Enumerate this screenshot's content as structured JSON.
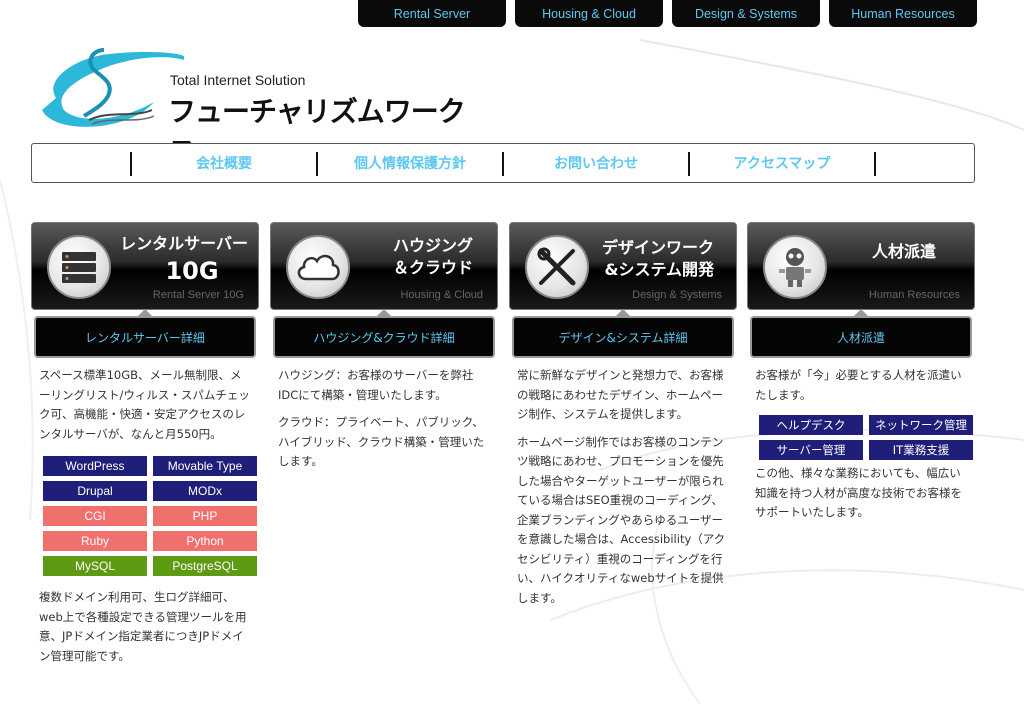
{
  "top_nav": [
    "Rental Server",
    "Housing & Cloud",
    "Design & Systems",
    "Human Resources"
  ],
  "logo": {
    "tagline": "Total Internet Solution",
    "name": "フューチャリズムワークス"
  },
  "main_nav": [
    "会社概要",
    "個人情報保護方針",
    "お問い合わせ",
    "アクセスマップ"
  ],
  "services": [
    {
      "title": "レンタルサーバー",
      "title2": "10G",
      "en": "Rental Server 10G",
      "button": "レンタルサーバー詳細",
      "text1": "スペース標準10GB、メール無制限、メーリングリスト/ウィルス・スパムチェック可、高機能・快適・安定アクセスのレンタルサーバが、なんと月550円。",
      "tags": [
        {
          "label": "WordPress",
          "color": "#1f1f7a"
        },
        {
          "label": "Movable Type",
          "color": "#1f1f7a"
        },
        {
          "label": "Drupal",
          "color": "#1f1f7a"
        },
        {
          "label": "MODx",
          "color": "#1f1f7a"
        },
        {
          "label": "CGI",
          "color": "#f0706e"
        },
        {
          "label": "PHP",
          "color": "#f0706e"
        },
        {
          "label": "Ruby",
          "color": "#f0706e"
        },
        {
          "label": "Python",
          "color": "#f0706e"
        },
        {
          "label": "MySQL",
          "color": "#5e9a14"
        },
        {
          "label": "PostgreSQL",
          "color": "#5e9a14"
        }
      ],
      "text2": "複数ドメイン利用可、生ログ詳細可、web上で各種設定できる管理ツールを用意、JPドメイン指定業者につきJPドメイン管理可能です。"
    },
    {
      "title": "ハウジング\n＆クラウド",
      "en": "Housing & Cloud",
      "button": "ハウジング&クラウド詳細",
      "text1": "ハウジング：お客様のサーバーを弊社IDCにて構築・管理いたします。",
      "text2": "クラウド：プライベート、パブリック、ハイブリッド、クラウド構築・管理いたします。"
    },
    {
      "title": "デザインワーク\n&システム開発",
      "en": "Design & Systems",
      "button": "デザイン&システム詳細",
      "text1": "常に新鮮なデザインと発想力で、お客様の戦略にあわせたデザイン、ホームページ制作、システムを提供します。",
      "text2": "ホームページ制作ではお客様のコンテンツ戦略にあわせ、プロモーションを優先した場合やターゲットユーザーが限られている場合はSEO重視のコーディング、企業ブランディングやあらゆるユーザーを意識した場合は、Accessibility（アクセシビリティ）重視のコーディングを行い、ハイクオリティなwebサイトを提供します。"
    },
    {
      "title": "人材派遣",
      "en": "Human Resources",
      "button": "人材派遣",
      "text1": "お客様が「今」必要とする人材を派遣いたします。",
      "tags": [
        "ヘルプデスク",
        "ネットワーク管理",
        "サーバー管理",
        "IT業務支援"
      ],
      "text2": "この他、様々な業務においても、幅広い知識を持つ人材が高度な技術でお客様をサポートいたします。"
    }
  ],
  "colors": {
    "accent": "#5ec8f0",
    "navy": "#1f1f7a",
    "pink": "#f0706e",
    "green": "#5e9a14"
  }
}
